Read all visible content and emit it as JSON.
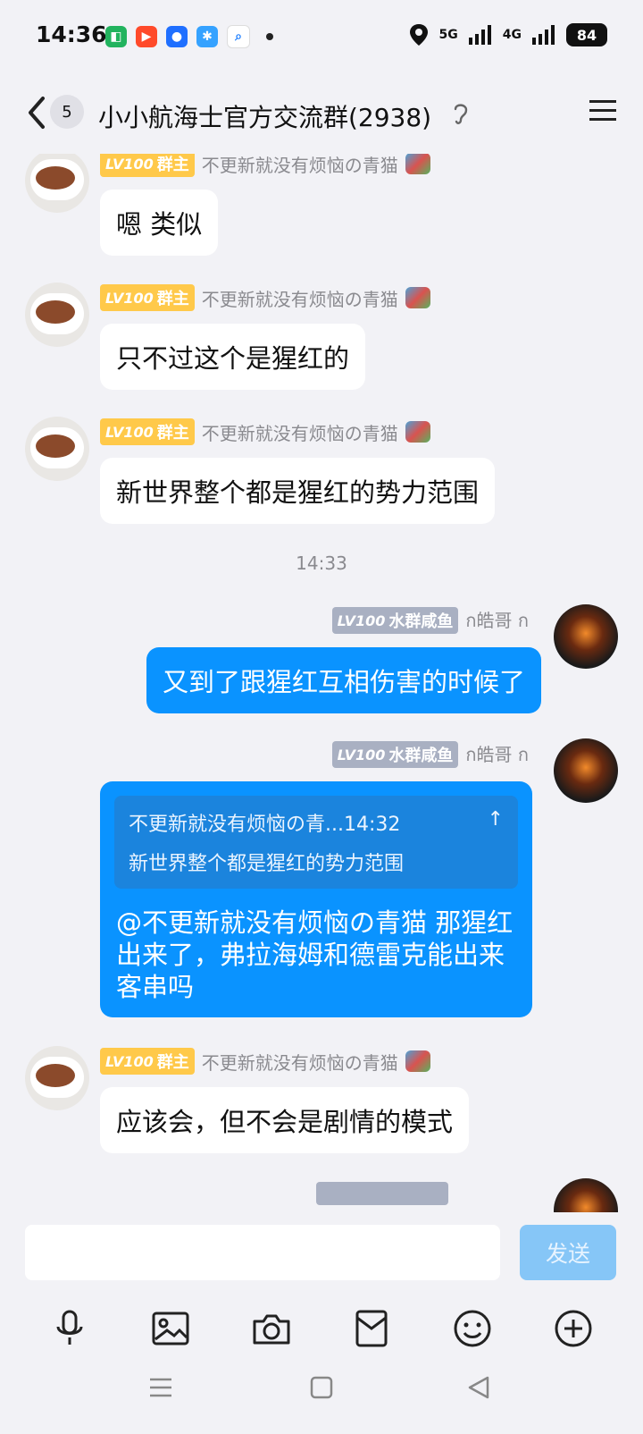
{
  "status": {
    "time": "14:36",
    "battery": "84",
    "net1": "5G",
    "net2": "4G"
  },
  "header": {
    "back_count": "5",
    "title": "小小航海士官方交流群(2938)"
  },
  "messages": [
    {
      "level": "LV100",
      "role": "群主",
      "name": "不更新就没有烦恼の青猫",
      "text": "嗯 类似"
    },
    {
      "level": "LV100",
      "role": "群主",
      "name": "不更新就没有烦恼の青猫",
      "text": "只不过这个是猩红的"
    },
    {
      "level": "LV100",
      "role": "群主",
      "name": "不更新就没有烦恼の青猫",
      "text": "新世界整个都是猩红的势力范围"
    },
    {
      "time": "14:33"
    },
    {
      "level": "LV100",
      "role": "水群咸鱼",
      "name": "ก皓哥 ก",
      "text": "又到了跟猩红互相伤害的时候了"
    },
    {
      "level": "LV100",
      "role": "水群咸鱼",
      "name": "ก皓哥 ก",
      "quote_head": "不更新就没有烦恼の青...14:32",
      "quote_text": "新世界整个都是猩红的势力范围",
      "text": "@不更新就没有烦恼の青猫 那猩红出来了，弗拉海姆和德雷克能出来客串吗"
    },
    {
      "level": "LV100",
      "role": "群主",
      "name": "不更新就没有烦恼の青猫",
      "text": "应该会，但不会是剧情的模式"
    }
  ],
  "input": {
    "placeholder": "",
    "send_label": "发送"
  },
  "toolbar": [
    "mic-icon",
    "image-icon",
    "camera-icon",
    "red-packet-icon",
    "emoji-icon",
    "plus-icon"
  ]
}
